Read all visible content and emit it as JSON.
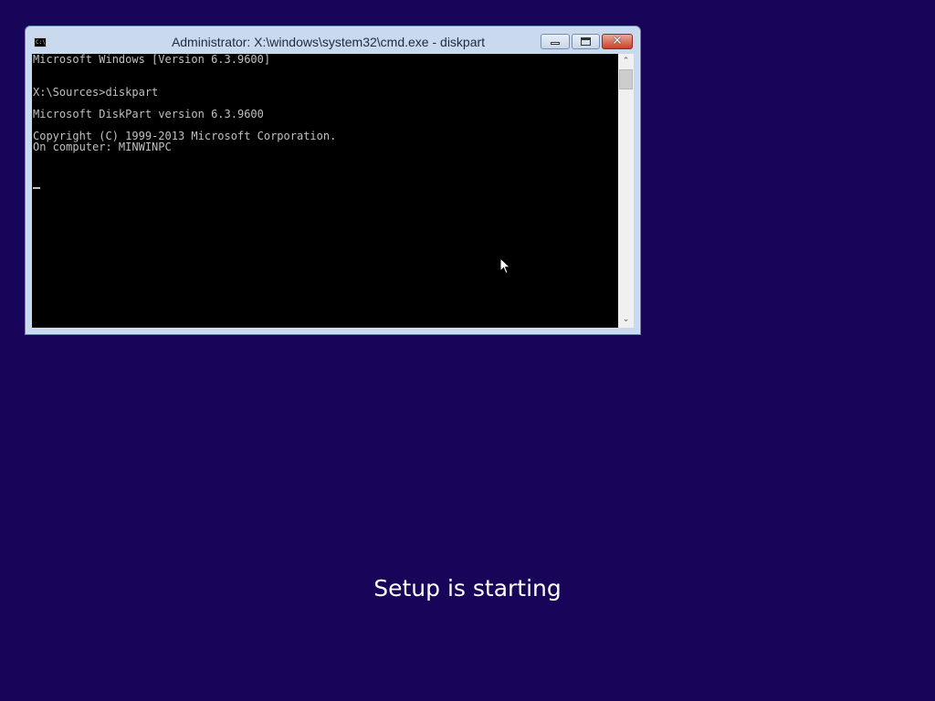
{
  "window": {
    "title": "Administrator: X:\\windows\\system32\\cmd.exe - diskpart",
    "icon": "console-icon",
    "icon_text": "C:\\",
    "minimize_label": "",
    "maximize_label": "",
    "close_label": "✕"
  },
  "console": {
    "lines": [
      "Microsoft Windows [Version 6.3.9600]",
      "",
      "",
      "X:\\Sources>diskpart",
      "",
      "Microsoft DiskPart version 6.3.9600",
      "",
      "Copyright (C) 1999-2013 Microsoft Corporation.",
      "On computer: MINWINPC",
      ""
    ],
    "text_color": "#c0c0c0",
    "background_color": "#000000"
  },
  "scrollbar": {
    "up_arrow": "⌃",
    "down_arrow": "⌄"
  },
  "desktop": {
    "background_color": "#180459",
    "status_text": "Setup is starting"
  }
}
